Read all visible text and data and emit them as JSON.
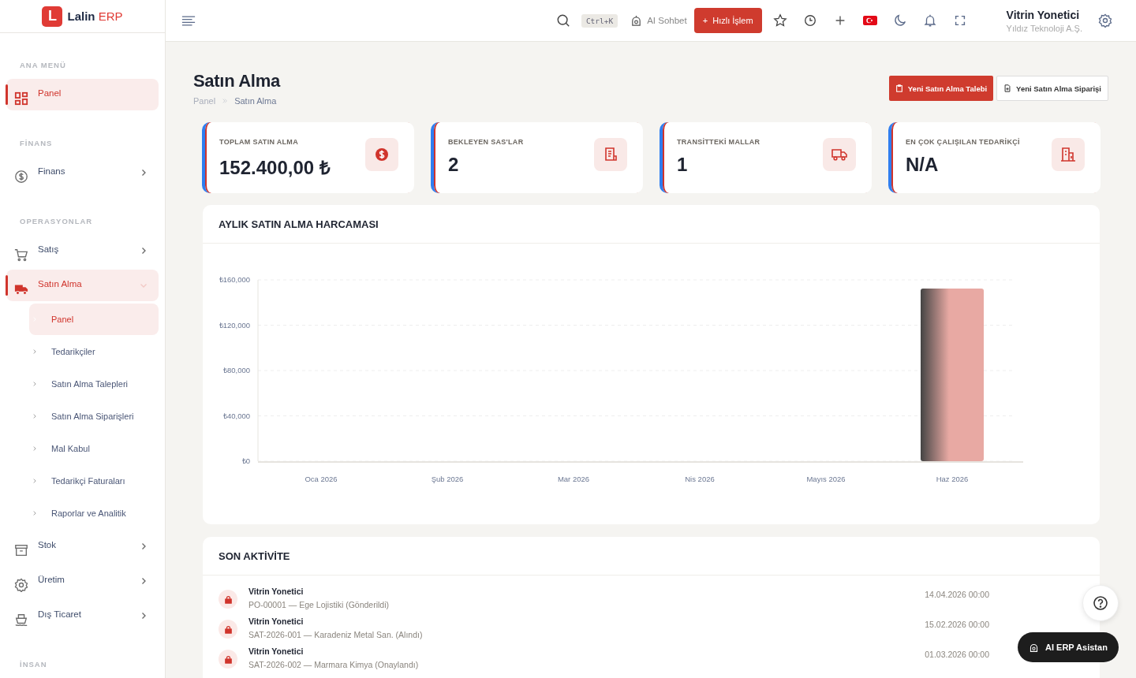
{
  "brand": {
    "letter": "L",
    "name": "Lalin",
    "suffix": "ERP"
  },
  "topbar": {
    "shortcut": "Ctrl+K",
    "ai_chat": "AI Sohbet",
    "quick_action": {
      "icon": "+",
      "label": "Hızlı İşlem"
    },
    "user": {
      "name": "Vitrin Yonetici",
      "company": "Yıldız Teknoloji A.Ş."
    }
  },
  "sidebar": {
    "sections": [
      {
        "title": "ANA MENÜ",
        "items": [
          {
            "label": "Panel",
            "selected": true,
            "has_children": false
          }
        ]
      },
      {
        "title": "FİNANS",
        "items": [
          {
            "label": "Finans",
            "selected": false,
            "has_children": true,
            "expanded": false
          }
        ]
      },
      {
        "title": "OPERASYONLAR",
        "items": [
          {
            "label": "Satış",
            "selected": false,
            "has_children": true,
            "expanded": false
          },
          {
            "label": "Satın Alma",
            "selected": true,
            "has_children": true,
            "expanded": true,
            "children": [
              {
                "label": "Panel",
                "selected": true
              },
              {
                "label": "Tedarikçiler",
                "selected": false
              },
              {
                "label": "Satın Alma Talepleri",
                "selected": false
              },
              {
                "label": "Satın Alma Siparişleri",
                "selected": false
              },
              {
                "label": "Mal Kabul",
                "selected": false
              },
              {
                "label": "Tedarikçi Faturaları",
                "selected": false
              },
              {
                "label": "Raporlar ve Analitik",
                "selected": false
              }
            ]
          },
          {
            "label": "Stok",
            "selected": false,
            "has_children": true,
            "expanded": false
          },
          {
            "label": "Üretim",
            "selected": false,
            "has_children": true,
            "expanded": false
          },
          {
            "label": "Dış Ticaret",
            "selected": false,
            "has_children": true,
            "expanded": false
          }
        ]
      },
      {
        "title": "İNSAN"
      }
    ]
  },
  "page": {
    "title": "Satın Alma",
    "breadcrumb": [
      "Panel",
      "Satın Alma"
    ],
    "actions": [
      {
        "label": "Yeni Satın Alma Talebi",
        "kind": "primary"
      },
      {
        "label": "Yeni Satın Alma Siparişi",
        "kind": "secondary"
      }
    ]
  },
  "stats": [
    {
      "label": "TOPLAM SATIN ALMA",
      "value": "152.400,00 ₺"
    },
    {
      "label": "BEKLEYEN SAS'LAR",
      "value": "2"
    },
    {
      "label": "TRANSİTTEKİ MALLAR",
      "value": "1"
    },
    {
      "label": "EN ÇOK ÇALIŞILAN TEDARİKÇİ",
      "value": "N/A"
    }
  ],
  "spend_chart": {
    "title": "AYLIK SATIN ALMA HARCAMASI",
    "chart_data": {
      "type": "bar",
      "categories": [
        "Oca 2026",
        "Şub 2026",
        "Mar 2026",
        "Nis 2026",
        "Mayıs 2026",
        "Haz 2026"
      ],
      "series": [
        {
          "color": "#e8a9a3",
          "values": [
            0,
            0,
            0,
            0,
            0,
            152400
          ]
        }
      ],
      "grid": true,
      "ylim": [
        0,
        160000
      ],
      "yticks": [
        {
          "value": 0,
          "label": "₺0"
        },
        {
          "value": 40000,
          "label": "₺40,000"
        },
        {
          "value": 80000,
          "label": "₺80,000"
        },
        {
          "value": 120000,
          "label": "₺120,000"
        },
        {
          "value": 160000,
          "label": "₺160,000"
        }
      ]
    }
  },
  "activity": {
    "title": "SON AKTİVİTE",
    "items": [
      {
        "user": "Vitrin Yonetici",
        "text": "PO-00001 — Ege Lojistiki (Gönderildi)",
        "time": "14.04.2026 00:00"
      },
      {
        "user": "Vitrin Yonetici",
        "text": "SAT-2026-001 — Karadeniz Metal San. (Alındı)",
        "time": "15.02.2026 00:00"
      },
      {
        "user": "Vitrin Yonetici",
        "text": "SAT-2026-002 — Marmara Kimya (Onaylandı)",
        "time": "01.03.2026 00:00"
      }
    ]
  },
  "assistant": {
    "label": "AI ERP Asistan"
  }
}
